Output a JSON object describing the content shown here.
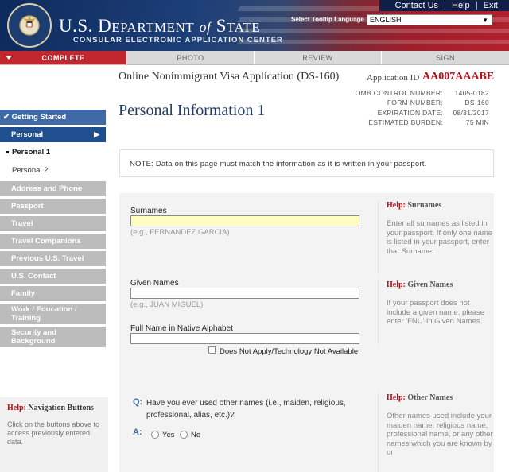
{
  "header": {
    "agency_title": "U.S. Department of State",
    "agency_subtitle": "CONSULAR ELECTRONIC APPLICATION CENTER",
    "links": [
      "Contact Us",
      "Help",
      "Exit"
    ],
    "tooltip_language_label": "Select Tooltip Language",
    "tooltip_language_value": "ENGLISH"
  },
  "tabs": [
    {
      "label": "COMPLETE",
      "active": true
    },
    {
      "label": "PHOTO",
      "active": false
    },
    {
      "label": "REVIEW",
      "active": false
    },
    {
      "label": "SIGN",
      "active": false
    }
  ],
  "application": {
    "name": "Online Nonimmigrant Visa Application (DS-160)",
    "id_label": "Application ID",
    "id_value": "AA007AAABE",
    "page_title": "Personal Information 1",
    "omb": [
      {
        "label": "OMB CONTROL NUMBER:",
        "value": "1405-0182"
      },
      {
        "label": "FORM NUMBER:",
        "value": "DS-160"
      },
      {
        "label": "EXPIRATION DATE:",
        "value": "08/31/2017"
      },
      {
        "label": "ESTIMATED BURDEN:",
        "value": "75 MIN"
      }
    ]
  },
  "nav": {
    "getting_started": "Getting Started",
    "personal": "Personal",
    "personal_1": "Personal 1",
    "personal_2": "Personal 2",
    "sections": [
      "Address and Phone",
      "Passport",
      "Travel",
      "Travel Companions",
      "Previous U.S. Travel",
      "U.S. Contact",
      "Family"
    ],
    "work_education": "Work / Education / Training",
    "security": "Security and Background"
  },
  "nav_help": {
    "prefix": "Help:",
    "title": "Navigation Buttons",
    "text": "Click on the buttons above to access previously entered data."
  },
  "note": "NOTE: Data on this page must match the information as it is written in your passport.",
  "form": {
    "surnames_label": "Surnames",
    "surnames_value": "",
    "surnames_hint": "(e.g., FERNANDEZ GARCIA)",
    "given_label": "Given Names",
    "given_value": "",
    "given_hint": "(e.g., JUAN MIGUEL)",
    "native_label": "Full Name in Native Alphabet",
    "native_value": "",
    "native_na_label": "Does Not Apply/Technology Not Available",
    "q_mark": "Q:",
    "question": "Have you ever used other names (i.e., maiden, religious, professional, alias, etc.)?",
    "a_mark": "A:",
    "yes_label": "Yes",
    "no_label": "No"
  },
  "help": {
    "prefix": "Help:",
    "surnames_title": "Surnames",
    "surnames_text": "Enter all surnames as listed in your passport. If only one name is listed in your passport, enter that Surname.",
    "given_title": "Given Names",
    "given_text": "If your passport does not include a given name, please enter 'FNU' in Given Names.",
    "other_title": "Other Names",
    "other_text": "Other names used include your maiden name, religious name, professional name, or any other names which you are known by or"
  },
  "colors": {
    "accent_red": "#c1272d",
    "nav_blue": "#1f4f8f",
    "title_blue": "#1f3b66",
    "app_id_red": "#b5121b"
  }
}
